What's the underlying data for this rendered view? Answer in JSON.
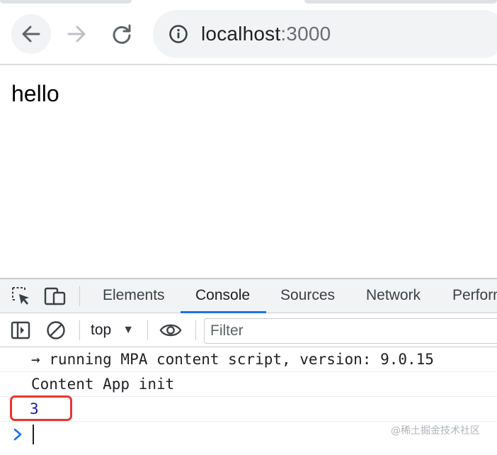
{
  "browser": {
    "url_host": "localhost",
    "url_port": ":3000",
    "icons": {
      "back": "arrow-left-icon",
      "forward": "arrow-right-icon",
      "reload": "reload-icon",
      "site_info": "info-icon"
    }
  },
  "page": {
    "text": "hello"
  },
  "devtools": {
    "tabs": [
      {
        "label": "Elements",
        "active": false
      },
      {
        "label": "Console",
        "active": true
      },
      {
        "label": "Sources",
        "active": false
      },
      {
        "label": "Network",
        "active": false
      },
      {
        "label": "Perform",
        "active": false
      }
    ],
    "context": "top",
    "filter_placeholder": "Filter",
    "console_lines": [
      {
        "text": "→ running MPA content script, version: 9.0.15"
      },
      {
        "text": "Content App init"
      },
      {
        "text": "3",
        "type": "number",
        "highlighted": true
      }
    ],
    "accent_color": "#1a73e8",
    "highlight_color": "#e8362c"
  },
  "watermark": "@稀土掘金技术社区"
}
